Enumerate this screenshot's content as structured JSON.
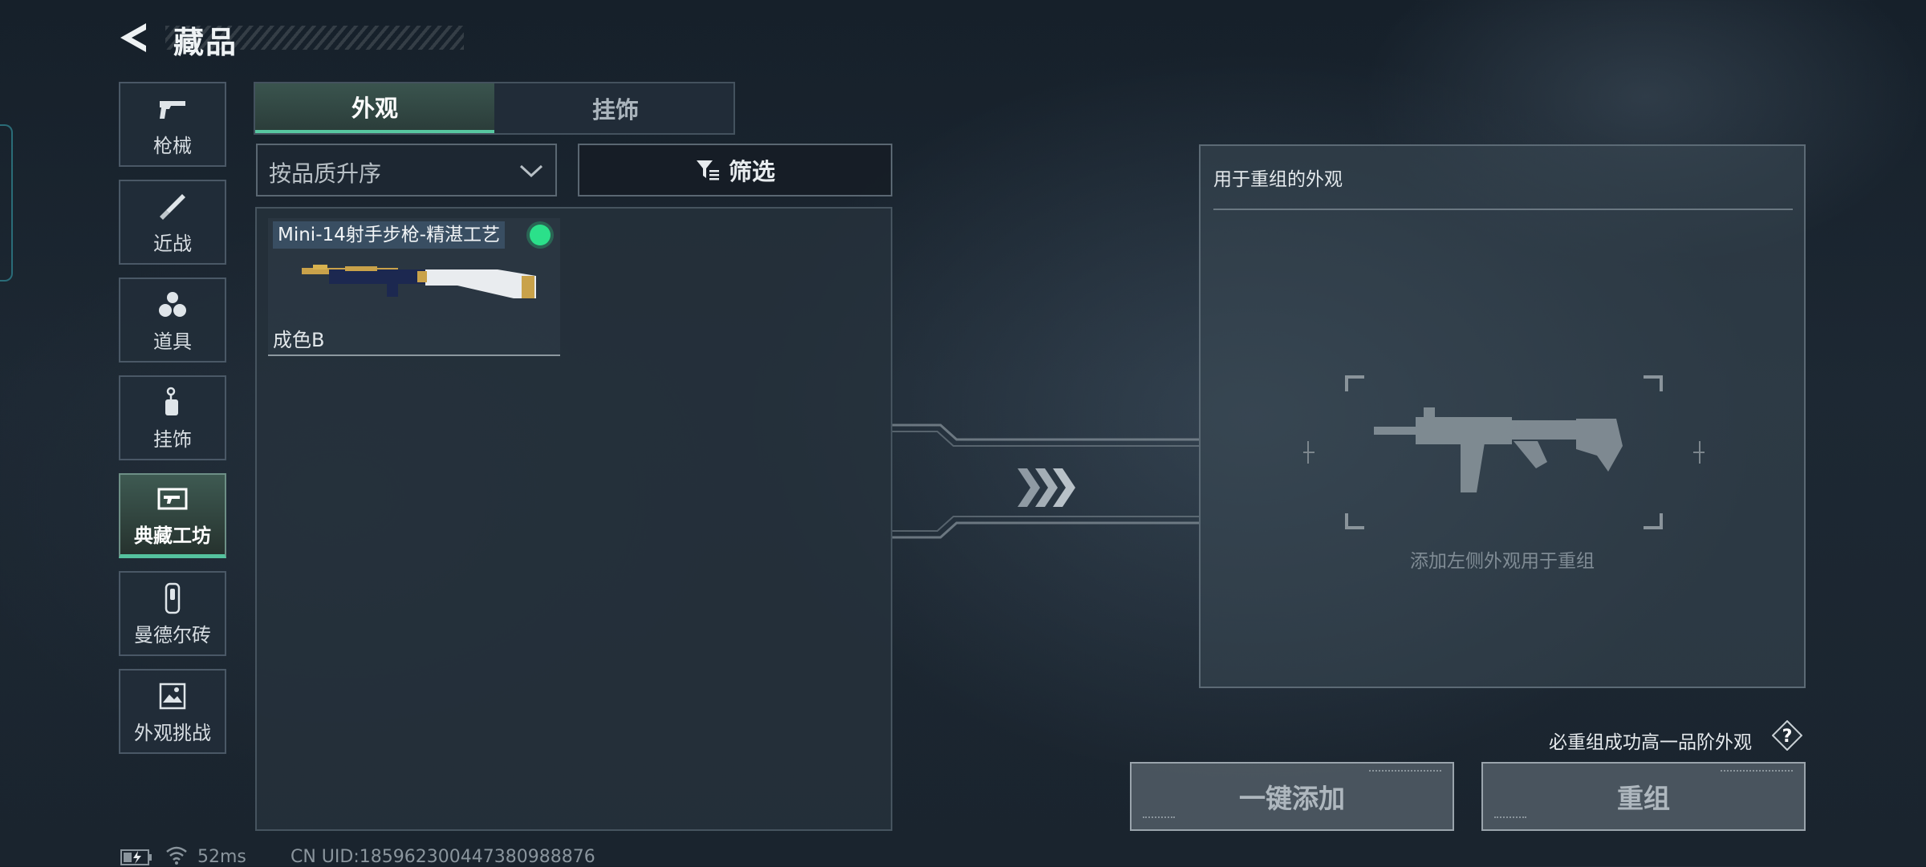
{
  "header": {
    "title": "藏品"
  },
  "sidebar": {
    "items": [
      {
        "label": "枪械",
        "icon": "pistol-icon"
      },
      {
        "label": "近战",
        "icon": "knife-icon"
      },
      {
        "label": "道具",
        "icon": "grenades-icon"
      },
      {
        "label": "挂饰",
        "icon": "keychain-icon"
      },
      {
        "label": "典藏工坊",
        "icon": "workshop-icon",
        "active": true
      },
      {
        "label": "曼德尔砖",
        "icon": "brick-icon"
      },
      {
        "label": "外观挑战",
        "icon": "image-challenge-icon"
      }
    ]
  },
  "tabs": [
    {
      "label": "外观",
      "active": true
    },
    {
      "label": "挂饰",
      "active": false
    }
  ],
  "sort": {
    "selected": "按品质升序"
  },
  "filter": {
    "label": "筛选"
  },
  "inventory": {
    "items": [
      {
        "name": "Mini-14射手步枪-精湛工艺",
        "grade": "成色B",
        "equipped": true
      }
    ]
  },
  "recombine": {
    "title": "用于重组的外观",
    "empty_hint": "添加左侧外观用于重组"
  },
  "guarantee_text": "必重组成功高一品阶外观",
  "buttons": {
    "one_click_add": "一键添加",
    "recombine": "重组"
  },
  "status": {
    "ping": "52ms",
    "uid": "CN UID:1859623004473809888​76"
  },
  "colors": {
    "accent": "#55c29e",
    "equipped": "#2be08a",
    "background": "#1d2833"
  }
}
